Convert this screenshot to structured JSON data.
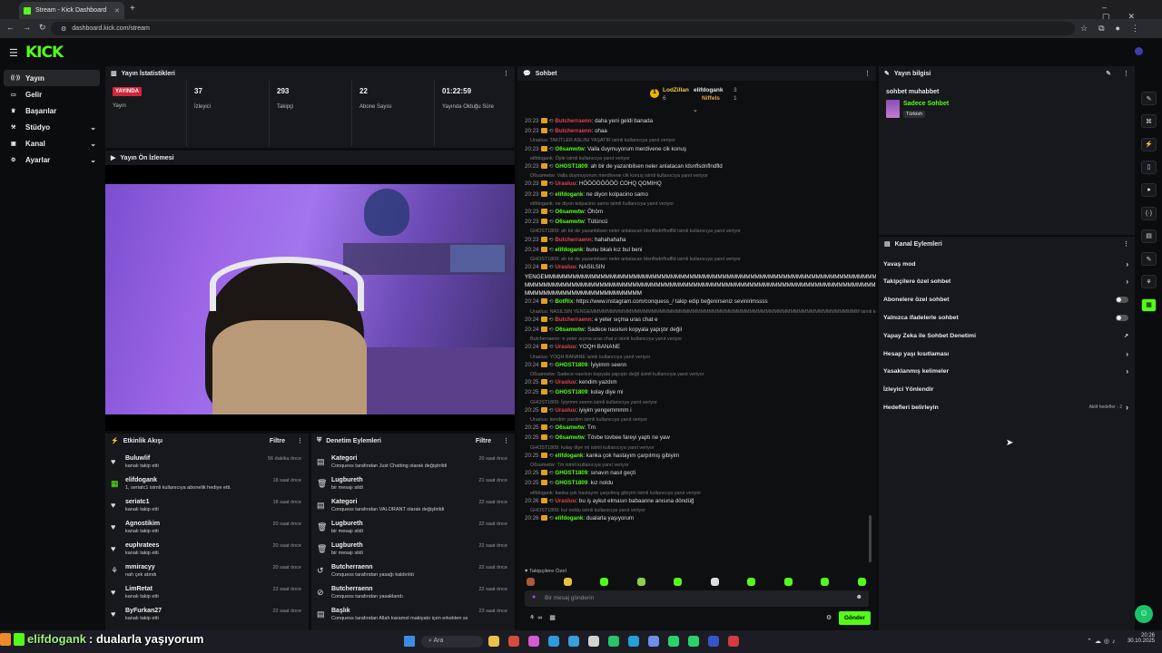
{
  "browser": {
    "tab_title": "Stream - Kick Dashboard",
    "url": "dashboard.kick.com/stream"
  },
  "nav": [
    {
      "label": "Yayın",
      "icon": "broadcast-icon",
      "active": true
    },
    {
      "label": "Gelir",
      "icon": "revenue-icon"
    },
    {
      "label": "Başarılar",
      "icon": "trophy-icon"
    },
    {
      "label": "Stüdyo",
      "icon": "studio-icon",
      "chev": true
    },
    {
      "label": "Kanal",
      "icon": "channel-icon",
      "chev": true
    },
    {
      "label": "Ayarlar",
      "icon": "settings-icon",
      "chev": true
    }
  ],
  "stats": {
    "title": "Yayın İstatistikleri",
    "live": "YAYINDA",
    "live_label": "Yayın",
    "viewers": "37",
    "viewers_label": "İzleyici",
    "followers": "293",
    "followers_label": "Takipçi",
    "subs": "22",
    "subs_label": "Abone Sayısı",
    "uptime": "01:22:59",
    "uptime_label": "Yayında Olduğu Süre"
  },
  "preview": {
    "title": "Yayın Ön İzlemesi"
  },
  "activity": {
    "title": "Etkinlik Akışı",
    "filter": "Filtre",
    "items": [
      {
        "name": "Buluwlif",
        "desc": "kanalı takip etti",
        "ago": "56 dakika önce"
      },
      {
        "name": "elifdogank",
        "desc": "1, seriatc1 isimli kullanıcıya abonelik hediye etti.",
        "ago": "18 saat önce"
      },
      {
        "name": "seriatc1",
        "desc": "kanalı takip etti",
        "ago": "18 saat önce"
      },
      {
        "name": "Agnostikim",
        "desc": "kanalı takip etti",
        "ago": "20 saat önce"
      },
      {
        "name": "euphratees",
        "desc": "kanalı takip etti",
        "ago": "20 saat önce"
      },
      {
        "name": "mmiracyy",
        "desc": "nah çek atındı",
        "ago": "20 saat önce"
      },
      {
        "name": "LimRetat",
        "desc": "kanalı takip etti",
        "ago": "22 saat önce"
      },
      {
        "name": "ByFurkan27",
        "desc": "kanalı takip etti",
        "ago": "22 saat önce"
      }
    ]
  },
  "mod": {
    "title": "Denetim Eylemleri",
    "filter": "Filtre",
    "items": [
      {
        "name": "Kategori",
        "desc": "Conquess tarafından Just Chatting olarak değiştirildi",
        "ago": "20 saat önce"
      },
      {
        "name": "Lugbureth",
        "desc": "bir mesajı sildi",
        "ago": "21 saat önce"
      },
      {
        "name": "Kategori",
        "desc": "Conquess tarafından VALORANT olarak değiştirildi",
        "ago": "22 saat önce"
      },
      {
        "name": "Lugbureth",
        "desc": "bir mesajı sildi",
        "ago": "22 saat önce"
      },
      {
        "name": "Lugbureth",
        "desc": "bir mesajı sildi",
        "ago": "22 saat önce"
      },
      {
        "name": "Butcherraenn",
        "desc": "Conquess tarafından yasağı kaldırıldı",
        "ago": "22 saat önce"
      },
      {
        "name": "Butcherraenn",
        "desc": "Conquess tarafından yasaklandı",
        "ago": "22 saat önce"
      },
      {
        "name": "Başlık",
        "desc": "Conquess tarafından Allah karamel makiyato içen erkekten sakınsın olarak değiştirildi",
        "ago": "23 saat önce"
      }
    ]
  },
  "chat": {
    "title": "Sohbet",
    "top": [
      {
        "name": "LodZillan",
        "count": "6"
      },
      {
        "name": "elifdogank",
        "count": "3"
      },
      {
        "name": "Niffels",
        "count": "1"
      }
    ],
    "placeholder": "Bir mesaj gönderin",
    "send": "Gönder",
    "followers_only": "Takipçilere Özel",
    "lines": [
      {
        "t": "20:23",
        "u": "Butcherraenn",
        "c": "#e0434d",
        "m": ": daha yeni geldi banada"
      },
      {
        "t": "20:23",
        "u": "Butcherraenn",
        "c": "#e0434d",
        "m": ": ohaa"
      },
      {
        "r": "Urasluu: TAKİTLER ASLINI YAŞATIR isimli kullanıcıya yanıt veriyor"
      },
      {
        "t": "20:23",
        "u": "O6samwtw",
        "c": "#53fc18",
        "m": ": Valla duymuyorum merdivene cik konuş"
      },
      {
        "r": "elifdogank: Öyle isimli kullanıcıya yanıt veriyor"
      },
      {
        "t": "20:23",
        "u": "GHOST1809",
        "c": "#53fc18",
        "m": ": ah bir de yazanbilsen neler anlatacan ldsnflsdnflndfld"
      },
      {
        "r": "O6samwtw: Valla duymuyorum merdivene cik konuş isimli kullanıcıya yanıt veriyor"
      },
      {
        "t": "20:23",
        "u": "Urasluu",
        "c": "#e0434d",
        "m": ": HÖÖÖÖÖÖÖÖ COHQ QOMIHQ"
      },
      {
        "t": "20:23",
        "u": "elifdogank",
        "c": "#53fc18",
        "m": ": ne diyon kolpacino samo"
      },
      {
        "r": "elifdogank: ne diyon kolpacino samo isimli kullanıcıya yanıt veriyor"
      },
      {
        "t": "20:23",
        "u": "O6samwtw",
        "c": "#53fc18",
        "m": ": Öhöm"
      },
      {
        "t": "20:23",
        "u": "O6samwtw",
        "c": "#53fc18",
        "m": ": Tütüncü"
      },
      {
        "r": "GHOST1809: ah bir de yazanbilsen neler anlatacan ldsnflsdnflndfld isimli kullanıcıya yanıt veriyor"
      },
      {
        "t": "20:23",
        "u": "Butcherraenn",
        "c": "#e0434d",
        "m": ": hahahahaha"
      },
      {
        "t": "20:24",
        "u": "elifdogank",
        "c": "#53fc18",
        "m": ": bunu bkalı kız bul beni"
      },
      {
        "r": "GHOST1809: ah bir de yazanbilsen neler anlatacan ldsnflsdnflndfld isimli kullanıcıya yanıt veriyor"
      },
      {
        "t": "20:24",
        "u": "Urasluu",
        "c": "#e0434d",
        "m": ": NASILSIN"
      },
      {
        "t": "",
        "u": "",
        "c": "#fff",
        "m": "YENGEMMMMMMMMMMMMMMMMMMMMMMMMMMMMMMMMMMMMMMMMMMMMMMMMMMMMMMMMMMMMMMMMMMMMMMMMMMMMMMMM"
      },
      {
        "t": "",
        "u": "",
        "c": "#fff",
        "m": "MMMMMMMMMMMMMMMMMMMMMMMMMMMMMMMMMMMMMMMMMMMMMMMMMMMMMMMMMMMMMMMMMMMMMMMMMMMMMMMMMMMMMMM"
      },
      {
        "t": "",
        "u": "",
        "c": "#fff",
        "m": "MMMMMMMMMMMMMMMMMMMMMMMMM"
      },
      {
        "t": "20:24",
        "u": "BotRix",
        "c": "#53fc18",
        "m": ": https://www.instagram.com/conquess_/ takip edip beğenirseniz sevinirimssss"
      },
      {
        "r": "Urasluu: NASILSIN YENGEMMMMMMMMMMMMMMMMMMMMMMMMMMMMMMMMMMMMMMMMMMMMMMMMMMMMMMMMMMMMMMMMMM isimli kullanıcıya yanıt veriyor"
      },
      {
        "t": "20:24",
        "u": "Butcherraenn",
        "c": "#e0434d",
        "m": ": e yeter sıçma uras chat e"
      },
      {
        "t": "20:24",
        "u": "O6samwtw",
        "c": "#53fc18",
        "m": ": Sadece nasılsın kopyala yapıştır değil"
      },
      {
        "r": "Butcherraenn: e yeter sıçma uras chat e isimli kullanıcıya yanıt veriyor"
      },
      {
        "t": "20:24",
        "u": "Urasluu",
        "c": "#e0434d",
        "m": ": YOQH BANANE"
      },
      {
        "r": "Urasluu: YOQH BANANE isimli kullanıcıya yanıt veriyor"
      },
      {
        "t": "20:24",
        "u": "GHOST1809",
        "c": "#53fc18",
        "m": ": İyiyimm seenn"
      },
      {
        "r": "O6samwtw: Sadece nasılsın kopyala yapıştır değil isimli kullanıcıya yanıt veriyor"
      },
      {
        "t": "20:25",
        "u": "Urasluu",
        "c": "#e0434d",
        "m": ": kendim yazdım"
      },
      {
        "t": "20:25",
        "u": "GHOST1809",
        "c": "#53fc18",
        "m": ": kolay diye mi"
      },
      {
        "r": "GHOST1809: İyiyimm seenn isimli kullanıcıya yanıt veriyor"
      },
      {
        "t": "20:25",
        "u": "Urasluu",
        "c": "#e0434d",
        "m": ": iyiyim yengemmmm i"
      },
      {
        "r": "Urasluu: kendim yazdım isimli kullanıcıya yanıt veriyor"
      },
      {
        "t": "20:25",
        "u": "O6samwtw",
        "c": "#53fc18",
        "m": ": Tm"
      },
      {
        "t": "20:25",
        "u": "O6samwtw",
        "c": "#53fc18",
        "m": ": Tövbe tovbee fareyi yaptı ne yaw"
      },
      {
        "r": "GHOST1809: kolay diye mi isimli kullanıcıya yanıt veriyor"
      },
      {
        "t": "20:25",
        "u": "elifdogank",
        "c": "#53fc18",
        "m": ": kanka çok hastayım çarpılmış gibiyim"
      },
      {
        "r": "O6samwtw: Tm isimli kullanıcıya yanıt veriyor"
      },
      {
        "t": "20:25",
        "u": "GHOST1809",
        "c": "#53fc18",
        "m": ": sınavın nasıl geçti"
      },
      {
        "t": "20:25",
        "u": "GHOST1809",
        "c": "#53fc18",
        "m": ": kız noldu"
      },
      {
        "r": "elifdogank: kanka çok hastayım çarpılmış gibiyim isimli kullanıcıya yanıt veriyor"
      },
      {
        "t": "20:26",
        "u": "Urasluu",
        "c": "#e0434d",
        "m": ": bu iş aykut elmasın babaanne anısına döndüğ"
      },
      {
        "r": "GHOST1809: kız noldu isimli kullanıcıya yanıt veriyor"
      },
      {
        "t": "20:26",
        "u": "elifdogank",
        "c": "#53fc18",
        "m": ": dualarla yaşıyorum"
      }
    ]
  },
  "info": {
    "title": "Yayın bilgisi",
    "stream_title": "sohbet muhabbet",
    "category": "Sadece Sohbet",
    "tag": "Türkish"
  },
  "actions": {
    "title": "Kanal Eylemleri",
    "items": [
      {
        "label": "Yavaş mod",
        "type": "chev"
      },
      {
        "label": "Takipçilere özel sohbet",
        "type": "chev"
      },
      {
        "label": "Abonelere özel sohbet",
        "type": "toggle"
      },
      {
        "label": "Yalnızca ifadelerle sohbet",
        "type": "toggle"
      },
      {
        "label": "Yapay Zeka ile Sohbet Denetimi",
        "type": "ext"
      },
      {
        "label": "Hesap yaşı kısıtlaması",
        "type": "chev"
      },
      {
        "label": "Yasaklanmış kelimeler",
        "type": "chev"
      },
      {
        "label": "İzleyici Yönlendir",
        "type": "none"
      },
      {
        "label": "Hedefleri belirleyin",
        "type": "chev"
      }
    ],
    "goals_badge": "Aktif hedefler - 2"
  },
  "caption": {
    "user": "elifdogank",
    "text": ": dualarla yaşıyorum"
  },
  "taskbar": {
    "search": "Ara",
    "time": "20:26",
    "date": "30.10.2025"
  }
}
